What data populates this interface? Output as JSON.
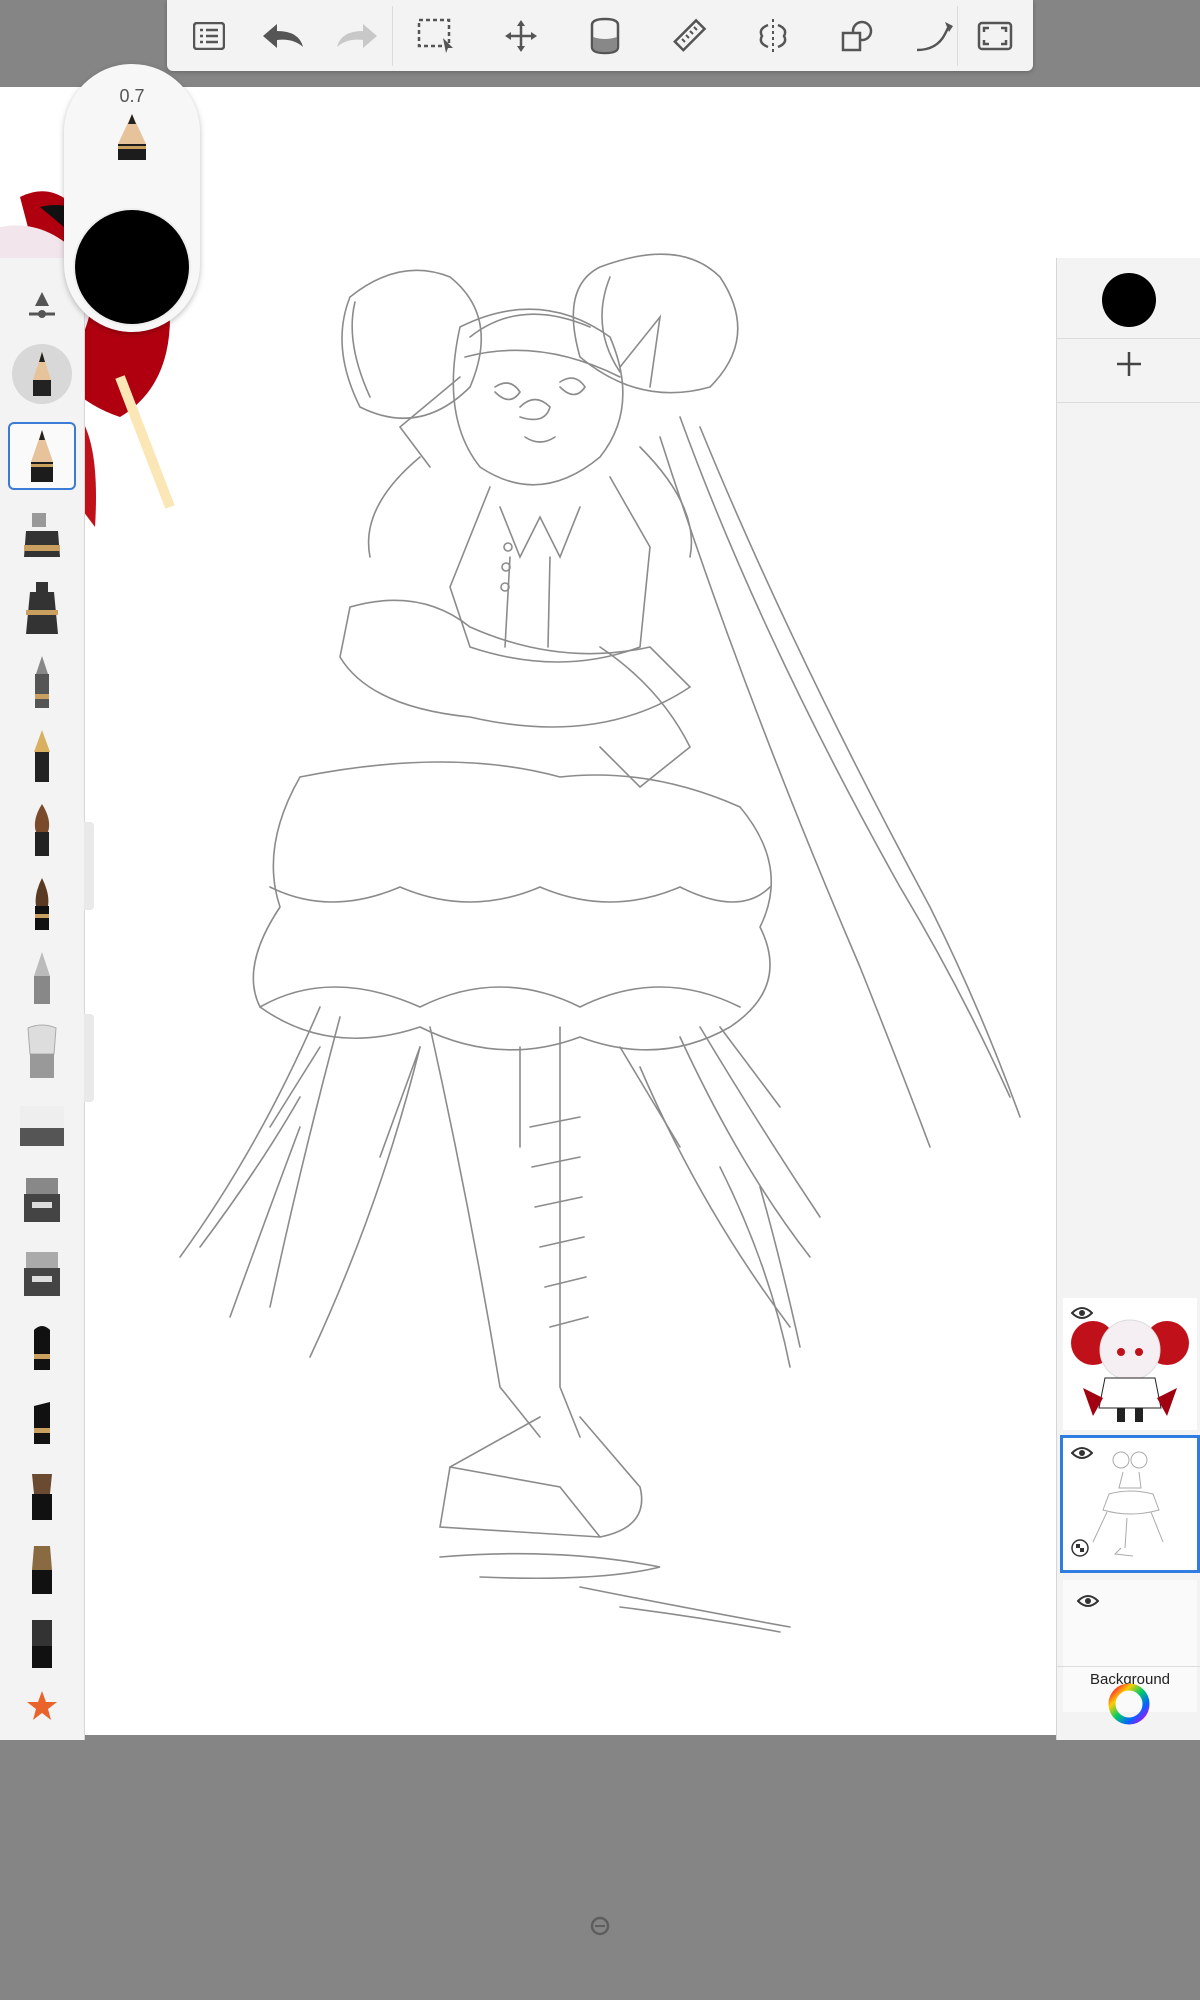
{
  "toolbar": {
    "items": [
      "list-icon",
      "undo-icon",
      "redo-icon",
      "selection-icon",
      "transform-icon",
      "fill-bucket-icon",
      "ruler-icon",
      "symmetry-icon",
      "shapes-icon",
      "stroke-icon",
      "fullscreen-icon"
    ]
  },
  "puck": {
    "brush_size": "0.7",
    "color": "#000000"
  },
  "brushes": {
    "items": [
      "brush-settings-icon",
      "pencil-recent",
      "pencil",
      "airbrush",
      "pen-ink",
      "ballpoint-pen",
      "fountain-pen",
      "paintbrush-round",
      "paintbrush-fine",
      "marker-chisel",
      "soft-brush",
      "eraser",
      "smudge-marker",
      "smudge-marker-2",
      "felt-tip",
      "felt-tip-2",
      "flat-brush",
      "flat-brush-2",
      "flat-brush-3",
      "favorites-star"
    ]
  },
  "layers": {
    "current_color": "#000000",
    "list": [
      {
        "name": "chibi-character-layer",
        "visible": true
      },
      {
        "name": "sketch-layer",
        "visible": true,
        "selected": true
      },
      {
        "label": "Background",
        "visible": true
      }
    ]
  },
  "colors": {
    "accent": "#2f7de1",
    "panel": "#f3f3f3",
    "frame": "#858585",
    "canvas": "#ffffff"
  }
}
